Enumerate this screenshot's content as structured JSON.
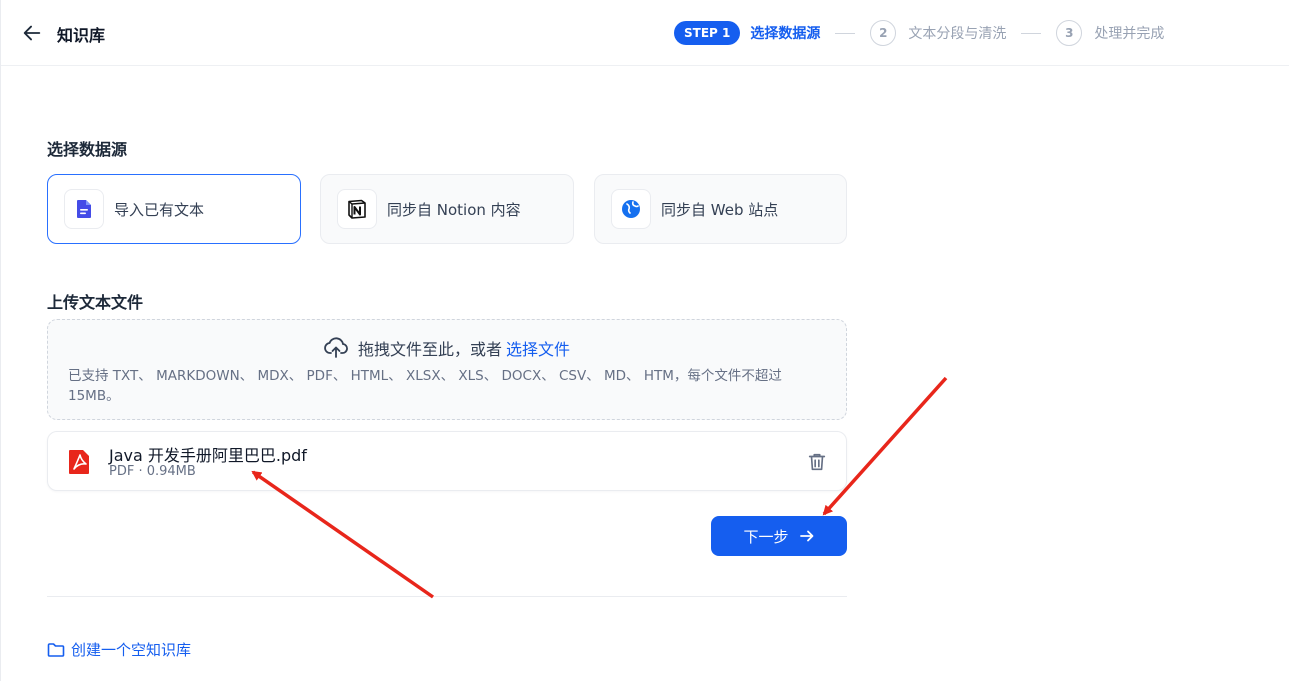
{
  "header": {
    "back_icon": "arrow-left-icon",
    "title": "知识库",
    "steps": [
      {
        "badge": "STEP 1",
        "label": "选择数据源",
        "active": true
      },
      {
        "badge": "2",
        "label": "文本分段与清洗",
        "active": false
      },
      {
        "badge": "3",
        "label": "处理并完成",
        "active": false
      }
    ]
  },
  "source_section": {
    "title": "选择数据源",
    "options": [
      {
        "label": "导入已有文本",
        "icon": "document-icon",
        "selected": true
      },
      {
        "label": "同步自 Notion 内容",
        "icon": "notion-icon",
        "selected": false
      },
      {
        "label": "同步自 Web 站点",
        "icon": "web-icon",
        "selected": false
      }
    ]
  },
  "upload_section": {
    "title": "上传文本文件",
    "drop_text": "拖拽文件至此，或者",
    "drop_link": "选择文件",
    "supported_text": "已支持 TXT、 MARKDOWN、 MDX、 PDF、 HTML、 XLSX、 XLS、 DOCX、 CSV、 MD、 HTM，每个文件不超过 15MB。",
    "upload_icon": "cloud-upload-icon"
  },
  "file": {
    "name": "Java 开发手册阿里巴巴.pdf",
    "meta": "PDF · 0.94MB",
    "icon": "pdf-icon"
  },
  "next_button": {
    "label": "下一步",
    "icon": "arrow-right-icon"
  },
  "create_empty": {
    "label": "创建一个空知识库",
    "icon": "folder-icon"
  },
  "colors": {
    "accent": "#155eef",
    "annotation": "#e8261b"
  }
}
